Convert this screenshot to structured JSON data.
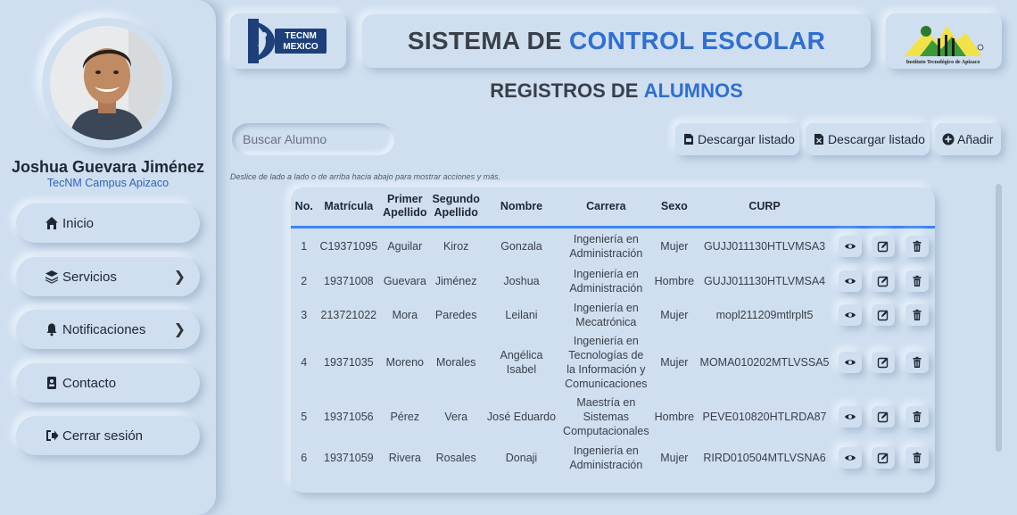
{
  "sidebar": {
    "user_name": "Joshua Guevara Jiménez",
    "campus": "TecNM Campus Apizaco",
    "items": [
      {
        "label": "Inicio",
        "icon": "home-icon",
        "chevron": false
      },
      {
        "label": "Servicios",
        "icon": "layers-icon",
        "chevron": true
      },
      {
        "label": "Notificaciones",
        "icon": "bell-icon",
        "chevron": true
      },
      {
        "label": "Contacto",
        "icon": "contact-card-icon",
        "chevron": false
      },
      {
        "label": "Cerrar sesión",
        "icon": "logout-icon",
        "chevron": false
      }
    ]
  },
  "header": {
    "logo_left": {
      "line1": "TECNM",
      "line2": "MEXICO"
    },
    "logo_right": {
      "caption": "Instituto Tecnológico de Apizaco"
    },
    "title_part1": "SISTEMA DE",
    "title_part2": "CONTROL ESCOLAR",
    "subtitle_part1": "REGISTROS DE",
    "subtitle_part2": "ALUMNOS"
  },
  "toolbar": {
    "search_placeholder": "Buscar Alumno",
    "download_pdf_label": "Descargar listado",
    "download_excel_label": "Descargar listado",
    "add_label": "Añadir",
    "hint": "Deslice de lado a lado o de arriba hacia abajo para mostrar acciones y más."
  },
  "table": {
    "headers": {
      "no": "No.",
      "matricula": "Matrícula",
      "primer_apellido": "Primer Apellido",
      "segundo_apellido": "Segundo Apellido",
      "nombre": "Nombre",
      "carrera": "Carrera",
      "sexo": "Sexo",
      "curp": "CURP"
    },
    "rows": [
      {
        "no": "1",
        "matricula": "C19371095",
        "primer": "Aguilar",
        "segundo": "Kiroz",
        "nombre": "Gonzala",
        "carrera": "Ingeniería en Administración",
        "sexo": "Mujer",
        "curp": "GUJJ011130HTLVMSA3"
      },
      {
        "no": "2",
        "matricula": "19371008",
        "primer": "Guevara",
        "segundo": "Jiménez",
        "nombre": "Joshua",
        "carrera": "Ingeniería en Administración",
        "sexo": "Hombre",
        "curp": "GUJJ011130HTLVMSA4"
      },
      {
        "no": "3",
        "matricula": "213721022",
        "primer": "Mora",
        "segundo": "Paredes",
        "nombre": "Leilani",
        "carrera": "Ingeniería en Mecatrónica",
        "sexo": "Mujer",
        "curp": "mopl211209mtlrplt5"
      },
      {
        "no": "4",
        "matricula": "19371035",
        "primer": "Moreno",
        "segundo": "Morales",
        "nombre": "Angélica Isabel",
        "carrera": "Ingeniería en Tecnologías de la Información y Comunicaciones",
        "sexo": "Mujer",
        "curp": "MOMA010202MTLVSSA5"
      },
      {
        "no": "5",
        "matricula": "19371056",
        "primer": "Pérez",
        "segundo": "Vera",
        "nombre": "José Eduardo",
        "carrera": "Maestría en Sistemas Computacionales",
        "sexo": "Hombre",
        "curp": "PEVE010820HTLRDA87"
      },
      {
        "no": "6",
        "matricula": "19371059",
        "primer": "Rivera",
        "segundo": "Rosales",
        "nombre": "Donaji",
        "carrera": "Ingeniería en Administración",
        "sexo": "Mujer",
        "curp": "RIRD010504MTLVSNA6"
      }
    ]
  },
  "colors": {
    "background": "#cfdff0",
    "accent_blue": "#2f6fd0",
    "header_underline": "#3b82f6"
  }
}
